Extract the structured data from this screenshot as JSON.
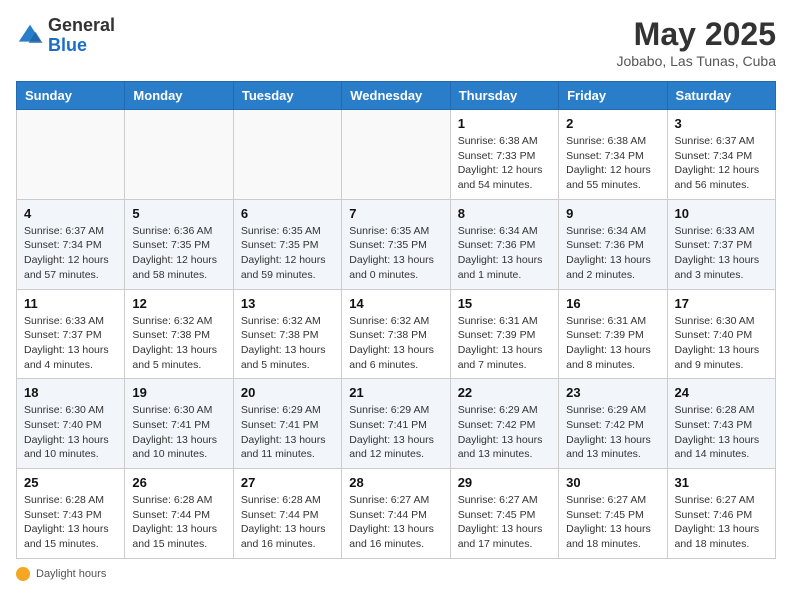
{
  "header": {
    "logo_general": "General",
    "logo_blue": "Blue",
    "month_title": "May 2025",
    "location": "Jobabo, Las Tunas, Cuba"
  },
  "days_of_week": [
    "Sunday",
    "Monday",
    "Tuesday",
    "Wednesday",
    "Thursday",
    "Friday",
    "Saturday"
  ],
  "footer": {
    "note": "Daylight hours"
  },
  "weeks": [
    [
      {
        "day": "",
        "info": ""
      },
      {
        "day": "",
        "info": ""
      },
      {
        "day": "",
        "info": ""
      },
      {
        "day": "",
        "info": ""
      },
      {
        "day": "1",
        "info": "Sunrise: 6:38 AM\nSunset: 7:33 PM\nDaylight: 12 hours and 54 minutes."
      },
      {
        "day": "2",
        "info": "Sunrise: 6:38 AM\nSunset: 7:34 PM\nDaylight: 12 hours and 55 minutes."
      },
      {
        "day": "3",
        "info": "Sunrise: 6:37 AM\nSunset: 7:34 PM\nDaylight: 12 hours and 56 minutes."
      }
    ],
    [
      {
        "day": "4",
        "info": "Sunrise: 6:37 AM\nSunset: 7:34 PM\nDaylight: 12 hours and 57 minutes."
      },
      {
        "day": "5",
        "info": "Sunrise: 6:36 AM\nSunset: 7:35 PM\nDaylight: 12 hours and 58 minutes."
      },
      {
        "day": "6",
        "info": "Sunrise: 6:35 AM\nSunset: 7:35 PM\nDaylight: 12 hours and 59 minutes."
      },
      {
        "day": "7",
        "info": "Sunrise: 6:35 AM\nSunset: 7:35 PM\nDaylight: 13 hours and 0 minutes."
      },
      {
        "day": "8",
        "info": "Sunrise: 6:34 AM\nSunset: 7:36 PM\nDaylight: 13 hours and 1 minute."
      },
      {
        "day": "9",
        "info": "Sunrise: 6:34 AM\nSunset: 7:36 PM\nDaylight: 13 hours and 2 minutes."
      },
      {
        "day": "10",
        "info": "Sunrise: 6:33 AM\nSunset: 7:37 PM\nDaylight: 13 hours and 3 minutes."
      }
    ],
    [
      {
        "day": "11",
        "info": "Sunrise: 6:33 AM\nSunset: 7:37 PM\nDaylight: 13 hours and 4 minutes."
      },
      {
        "day": "12",
        "info": "Sunrise: 6:32 AM\nSunset: 7:38 PM\nDaylight: 13 hours and 5 minutes."
      },
      {
        "day": "13",
        "info": "Sunrise: 6:32 AM\nSunset: 7:38 PM\nDaylight: 13 hours and 5 minutes."
      },
      {
        "day": "14",
        "info": "Sunrise: 6:32 AM\nSunset: 7:38 PM\nDaylight: 13 hours and 6 minutes."
      },
      {
        "day": "15",
        "info": "Sunrise: 6:31 AM\nSunset: 7:39 PM\nDaylight: 13 hours and 7 minutes."
      },
      {
        "day": "16",
        "info": "Sunrise: 6:31 AM\nSunset: 7:39 PM\nDaylight: 13 hours and 8 minutes."
      },
      {
        "day": "17",
        "info": "Sunrise: 6:30 AM\nSunset: 7:40 PM\nDaylight: 13 hours and 9 minutes."
      }
    ],
    [
      {
        "day": "18",
        "info": "Sunrise: 6:30 AM\nSunset: 7:40 PM\nDaylight: 13 hours and 10 minutes."
      },
      {
        "day": "19",
        "info": "Sunrise: 6:30 AM\nSunset: 7:41 PM\nDaylight: 13 hours and 10 minutes."
      },
      {
        "day": "20",
        "info": "Sunrise: 6:29 AM\nSunset: 7:41 PM\nDaylight: 13 hours and 11 minutes."
      },
      {
        "day": "21",
        "info": "Sunrise: 6:29 AM\nSunset: 7:41 PM\nDaylight: 13 hours and 12 minutes."
      },
      {
        "day": "22",
        "info": "Sunrise: 6:29 AM\nSunset: 7:42 PM\nDaylight: 13 hours and 13 minutes."
      },
      {
        "day": "23",
        "info": "Sunrise: 6:29 AM\nSunset: 7:42 PM\nDaylight: 13 hours and 13 minutes."
      },
      {
        "day": "24",
        "info": "Sunrise: 6:28 AM\nSunset: 7:43 PM\nDaylight: 13 hours and 14 minutes."
      }
    ],
    [
      {
        "day": "25",
        "info": "Sunrise: 6:28 AM\nSunset: 7:43 PM\nDaylight: 13 hours and 15 minutes."
      },
      {
        "day": "26",
        "info": "Sunrise: 6:28 AM\nSunset: 7:44 PM\nDaylight: 13 hours and 15 minutes."
      },
      {
        "day": "27",
        "info": "Sunrise: 6:28 AM\nSunset: 7:44 PM\nDaylight: 13 hours and 16 minutes."
      },
      {
        "day": "28",
        "info": "Sunrise: 6:27 AM\nSunset: 7:44 PM\nDaylight: 13 hours and 16 minutes."
      },
      {
        "day": "29",
        "info": "Sunrise: 6:27 AM\nSunset: 7:45 PM\nDaylight: 13 hours and 17 minutes."
      },
      {
        "day": "30",
        "info": "Sunrise: 6:27 AM\nSunset: 7:45 PM\nDaylight: 13 hours and 18 minutes."
      },
      {
        "day": "31",
        "info": "Sunrise: 6:27 AM\nSunset: 7:46 PM\nDaylight: 13 hours and 18 minutes."
      }
    ]
  ]
}
